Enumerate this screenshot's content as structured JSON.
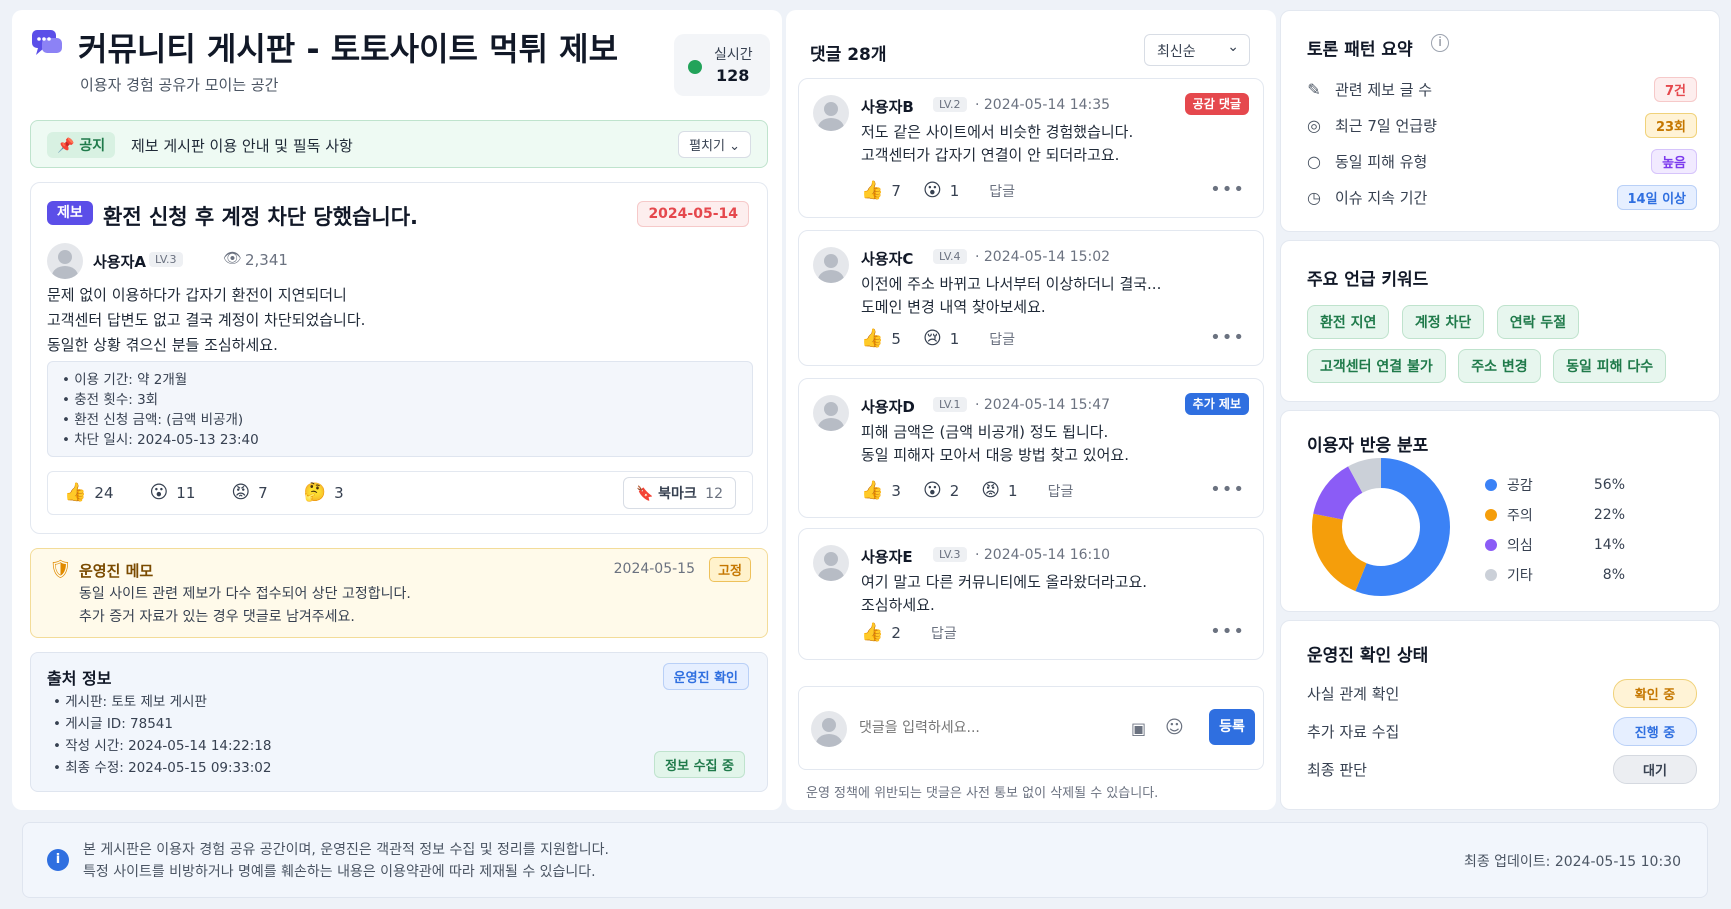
{
  "colors": {
    "accent": "#2f6fe0",
    "danger": "#e5484d",
    "warning": "#e8a317",
    "success": "#22a35a",
    "purple": "#8b5cf6"
  },
  "header": {
    "title": "커뮤니티 게시판 - 토토사이트 먹튀 제보",
    "subtitle": "이용자 경험 공유가 모이는 공간",
    "live_label": "실시간",
    "live_count": "128",
    "icon": "chat-bubbles-icon"
  },
  "notice": {
    "tag": "공지",
    "text": "제보 게시판 이용 안내 및 필독 사항",
    "expand": "펼치기"
  },
  "post": {
    "category": "제보",
    "title": "환전 신청 후 계정 차단 당했습니다.",
    "date": "2024-05-14",
    "author": "사용자A",
    "level": "LV.3",
    "views": "2,341",
    "body": [
      "문제 없이 이용하다가 갑자기 환전이 지연되더니",
      "고객센터 답변도 없고 결국 계정이 차단되었습니다.",
      "동일한 상황 겪으신 분들 조심하세요."
    ],
    "details": [
      "이용 기간: 약 2개월",
      "충전 횟수: 3회",
      "환전 신청 금액: (금액 비공개)",
      "차단 일시: 2024-05-13 23:40"
    ],
    "reactions": [
      {
        "emoji": "👍",
        "count": "24"
      },
      {
        "emoji": "😮",
        "count": "11"
      },
      {
        "emoji": "😡",
        "count": "7"
      },
      {
        "emoji": "🤔",
        "count": "3"
      }
    ],
    "bookmark_label": "북마크",
    "bookmark_count": "12"
  },
  "admin_memo": {
    "title": "운영진 메모",
    "date": "2024-05-15",
    "badge": "고정",
    "lines": [
      "동일 사이트 관련 제보가 다수 접수되어 상단 고정합니다.",
      "추가 증거 자료가 있는 경우 댓글로 남겨주세요."
    ]
  },
  "source": {
    "title": "출처 정보",
    "badge": "운영진 확인",
    "items": [
      "게시판: 토토 제보 게시판",
      "게시글 ID: 78541",
      "작성 시간: 2024-05-14 14:22:18",
      "최종 수정: 2024-05-15 09:33:02"
    ],
    "status": "정보 수집 중"
  },
  "comments": {
    "title": "댓글 28개",
    "sort": "최신순",
    "reply_label": "답글",
    "items": [
      {
        "author": "사용자B",
        "level": "LV.2",
        "time": "· 2024-05-14 14:35",
        "badge": "공감 댓글",
        "lines": [
          "저도 같은 사이트에서 비슷한 경험했습니다.",
          "고객센터가 갑자기 연결이 안 되더라고요."
        ],
        "reactions": [
          {
            "emoji": "👍",
            "count": "7"
          },
          {
            "emoji": "😮",
            "count": "1"
          }
        ]
      },
      {
        "author": "사용자C",
        "level": "LV.4",
        "time": "· 2024-05-14 15:02",
        "badge": "",
        "lines": [
          "이전에 주소 바뀌고 나서부터 이상하더니 결국...",
          "도메인 변경 내역 찾아보세요."
        ],
        "reactions": [
          {
            "emoji": "👍",
            "count": "5"
          },
          {
            "emoji": "😢",
            "count": "1"
          }
        ]
      },
      {
        "author": "사용자D",
        "level": "LV.1",
        "time": "· 2024-05-14 15:47",
        "badge": "추가 제보",
        "lines": [
          "피해 금액은 (금액 비공개) 정도 됩니다.",
          "동일 피해자 모아서 대응 방법 찾고 있어요."
        ],
        "reactions": [
          {
            "emoji": "👍",
            "count": "3"
          },
          {
            "emoji": "😮",
            "count": "2"
          },
          {
            "emoji": "😡",
            "count": "1"
          }
        ]
      },
      {
        "author": "사용자E",
        "level": "LV.3",
        "time": "· 2024-05-14 16:10",
        "badge": "",
        "lines": [
          "여기 말고 다른 커뮤니티에도 올라왔더라고요.",
          "조심하세요."
        ],
        "reactions": [
          {
            "emoji": "👍",
            "count": "2"
          }
        ]
      }
    ],
    "input_placeholder": "댓글을 입력하세요...",
    "submit": "등록",
    "policy": "운영 정책에 위반되는 댓글은 사전 통보 없이 삭제될 수 있습니다."
  },
  "summary": {
    "title": "토론 패턴 요약",
    "rows": [
      {
        "label": "관련 제보 글 수",
        "value": "7건",
        "icon": "edit-icon"
      },
      {
        "label": "최근 7일 언급량",
        "value": "23회",
        "icon": "target-icon"
      },
      {
        "label": "동일 피해 유형",
        "value": "높음",
        "icon": "circle-icon"
      },
      {
        "label": "이슈 지속 기간",
        "value": "14일 이상",
        "icon": "clock-icon"
      }
    ]
  },
  "keywords": {
    "title": "주요 언급 키워드",
    "items": [
      "환전 지연",
      "계정 차단",
      "연락 두절",
      "고객센터 연결 불가",
      "주소 변경",
      "동일 피해 다수"
    ]
  },
  "reactions_dist": {
    "title": "이용자 반응 분포",
    "items": [
      {
        "label": "공감",
        "pct": "56%",
        "value": 56,
        "color": "#3b82f6"
      },
      {
        "label": "주의",
        "pct": "22%",
        "value": 22,
        "color": "#f59e0b"
      },
      {
        "label": "의심",
        "pct": "14%",
        "value": 14,
        "color": "#8b5cf6"
      },
      {
        "label": "기타",
        "pct": "8%",
        "value": 8,
        "color": "#cbd0d8"
      }
    ]
  },
  "status": {
    "title": "운영진 확인 상태",
    "rows": [
      {
        "label": "사실 관계 확인",
        "value": "확인 중"
      },
      {
        "label": "추가 자료 수집",
        "value": "진행 중"
      },
      {
        "label": "최종 판단",
        "value": "대기"
      }
    ]
  },
  "footer": {
    "lines": [
      "본 게시판은 이용자 경험 공유 공간이며, 운영진은 객관적 정보 수집 및 정리를 지원합니다.",
      "특정 사이트를 비방하거나 명예를 훼손하는 내용은 이용약관에 따라 제재될 수 있습니다."
    ],
    "updated": "최종 업데이트: 2024-05-15 10:30"
  }
}
